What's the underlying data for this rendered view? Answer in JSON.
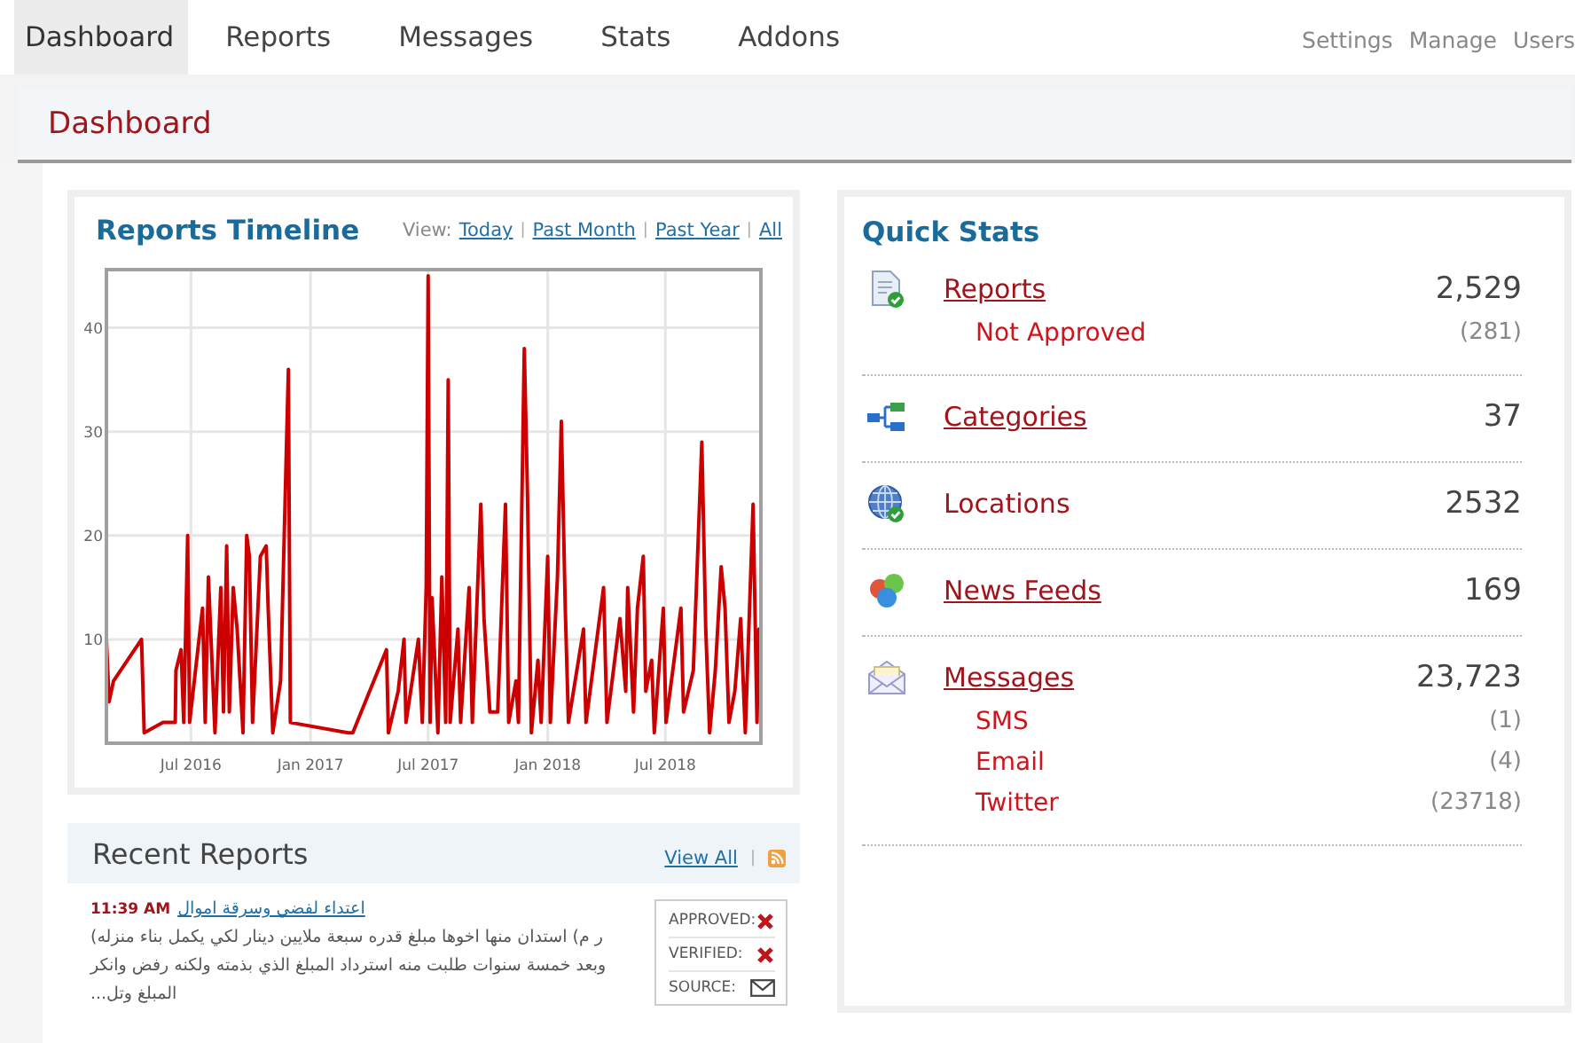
{
  "nav": {
    "tabs": [
      {
        "label": "Dashboard",
        "selected": true
      },
      {
        "label": "Reports",
        "selected": false
      },
      {
        "label": "Messages",
        "selected": false
      },
      {
        "label": "Stats",
        "selected": false
      },
      {
        "label": "Addons",
        "selected": false
      }
    ],
    "links": [
      "Settings",
      "Manage",
      "Users"
    ]
  },
  "page_title": "Dashboard",
  "timeline": {
    "title": "Reports Timeline",
    "view_label": "View:",
    "view_links": [
      "Today",
      "Past Month",
      "Past Year",
      "All"
    ],
    "separator": "|",
    "chart_data": {
      "type": "line",
      "x": [
        "2016-02-22",
        "2016-02-26",
        "2016-03-04",
        "2016-04-16",
        "2016-04-20",
        "2016-05-19",
        "2016-06-07",
        "2016-06-08",
        "2016-06-16",
        "2016-06-20",
        "2016-06-26",
        "2016-06-29",
        "2016-07-19",
        "2016-07-23",
        "2016-07-28",
        "2016-08-07",
        "2016-08-16",
        "2016-08-20",
        "2016-08-25",
        "2016-08-29",
        "2016-09-04",
        "2016-09-10",
        "2016-09-19",
        "2016-09-25",
        "2016-09-29",
        "2016-10-04",
        "2016-10-16",
        "2016-10-25",
        "2016-10-28",
        "2016-11-04",
        "2016-11-16",
        "2016-11-28",
        "2016-12-01",
        "2017-02-28",
        "2017-03-07",
        "2017-04-28",
        "2017-05-01",
        "2017-05-16",
        "2017-05-25",
        "2017-05-28",
        "2017-06-16",
        "2017-06-22",
        "2017-06-28",
        "2017-07-01",
        "2017-07-04",
        "2017-07-07",
        "2017-07-16",
        "2017-07-22",
        "2017-07-28",
        "2017-08-01",
        "2017-08-04",
        "2017-08-16",
        "2017-08-20",
        "2017-09-02",
        "2017-09-07",
        "2017-09-20",
        "2017-09-25",
        "2017-10-04",
        "2017-10-16",
        "2017-10-28",
        "2017-11-02",
        "2017-11-13",
        "2017-11-17",
        "2017-11-26",
        "2017-12-01",
        "2017-12-07",
        "2017-12-17",
        "2017-12-22",
        "2018-01-01",
        "2018-01-05",
        "2018-01-16",
        "2018-01-22",
        "2018-01-28",
        "2018-02-02",
        "2018-02-25",
        "2018-03-01",
        "2018-03-28",
        "2018-04-02",
        "2018-04-22",
        "2018-05-01",
        "2018-05-04",
        "2018-05-13",
        "2018-05-19",
        "2018-05-28",
        "2018-06-01",
        "2018-06-10",
        "2018-06-14",
        "2018-06-28",
        "2018-07-02",
        "2018-07-25",
        "2018-07-29",
        "2018-08-13",
        "2018-08-26",
        "2018-09-01",
        "2018-09-07",
        "2018-09-16",
        "2018-09-25",
        "2018-10-01",
        "2018-10-07",
        "2018-10-16",
        "2018-10-25",
        "2018-11-01",
        "2018-11-07",
        "2018-11-13",
        "2018-11-19",
        "2018-11-22",
        "2018-11-25"
      ],
      "series": [
        {
          "color": "#cc0000",
          "values": [
            10,
            4,
            6,
            10,
            1,
            2,
            2,
            7,
            9,
            2,
            20,
            2,
            13,
            2,
            16,
            1,
            15,
            3,
            19,
            3,
            15,
            11,
            1,
            20,
            18,
            2,
            18,
            19,
            13,
            1,
            6,
            36,
            2,
            1,
            1,
            9,
            1,
            5,
            10,
            2,
            10,
            2,
            15,
            45,
            2,
            14,
            1,
            16,
            2,
            35,
            2,
            11,
            2,
            15,
            2,
            23,
            12,
            3,
            3,
            23,
            2,
            6,
            2,
            38,
            24,
            1,
            8,
            2,
            18,
            2,
            16,
            31,
            13,
            2,
            11,
            2,
            15,
            2,
            12,
            5,
            15,
            3,
            13,
            18,
            5,
            8,
            1,
            13,
            2,
            13,
            3,
            7,
            29,
            11,
            1,
            7,
            17,
            13,
            2,
            5,
            12,
            1,
            12,
            23,
            2,
            11,
            5
          ]
        }
      ],
      "grid": true,
      "xlim": [
        "2016-02-22",
        "2018-11-25"
      ],
      "ylim": [
        0,
        45.6
      ],
      "xticks": [
        {
          "value": "2016-07-01",
          "label": "Jul 2016"
        },
        {
          "value": "2017-01-01",
          "label": "Jan 2017"
        },
        {
          "value": "2017-07-01",
          "label": "Jul 2017"
        },
        {
          "value": "2018-01-01",
          "label": "Jan 2018"
        },
        {
          "value": "2018-07-01",
          "label": "Jul 2018"
        }
      ],
      "yticks": [
        10,
        20,
        30,
        40
      ]
    }
  },
  "recent_reports": {
    "title": "Recent Reports",
    "view_all": "View All",
    "separator": "|",
    "reports": [
      {
        "time": "11:39 AM",
        "title": "اعتداء لفضي وسرقة اموال",
        "description": "ر م) استدان منها اخوها مبلغ قدره سبعة ملايين دينار لكي يكمل بناء منزله) وبعد خمسة سنوات طلبت منه استرداد المبلغ الذي بذمته ولكنه رفض وانكر المبلغ وتل...",
        "approved_label": "APPROVED:",
        "approved": false,
        "verified_label": "VERIFIED:",
        "verified": false,
        "source_label": "SOURCE:",
        "source": {
          "kind": "email"
        }
      }
    ]
  },
  "quick_stats": {
    "title": "Quick Stats",
    "items": [
      {
        "kind": "report",
        "label": "Reports",
        "linked": true,
        "value": "2,529",
        "subitems": [
          {
            "label": "Not Approved",
            "value": "(281)"
          }
        ]
      },
      {
        "kind": "categories",
        "label": "Categories",
        "linked": true,
        "value": "37"
      },
      {
        "kind": "globe",
        "label": "Locations",
        "linked": false,
        "value": "2532"
      },
      {
        "kind": "feeds",
        "label": "News Feeds",
        "linked": true,
        "value": "169"
      },
      {
        "kind": "envelope",
        "label": "Messages",
        "linked": true,
        "value": "23,723",
        "subitems": [
          {
            "label": "SMS",
            "value": "(1)"
          },
          {
            "label": "Email",
            "value": "(4)"
          },
          {
            "label": "Twitter",
            "value": "(23718)"
          }
        ]
      }
    ]
  }
}
